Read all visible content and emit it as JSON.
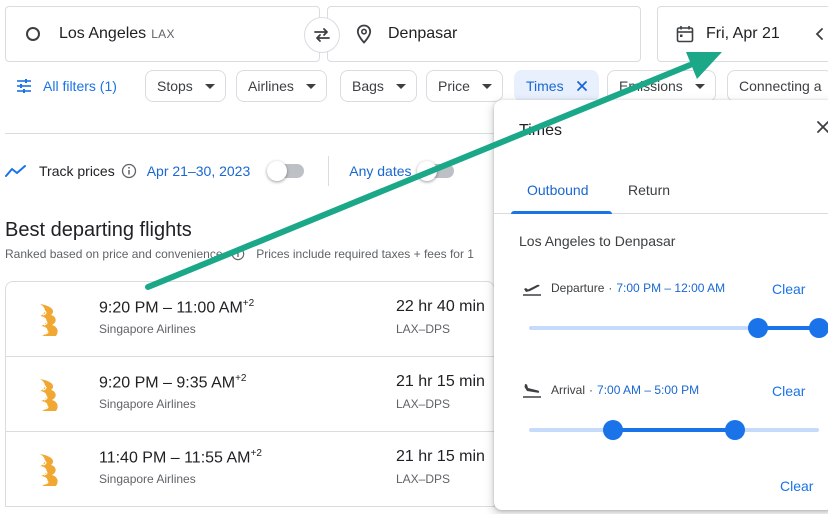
{
  "search": {
    "origin": "Los Angeles",
    "origin_code": "LAX",
    "destination": "Denpasar",
    "date": "Fri, Apr 21"
  },
  "filters": {
    "all_filters": "All filters (1)",
    "chips": [
      "Stops",
      "Airlines",
      "Bags",
      "Price",
      "Times",
      "Emissions",
      "Connecting a"
    ]
  },
  "track": {
    "label": "Track prices",
    "dates": "Apr 21–30, 2023",
    "any_dates": "Any dates"
  },
  "results": {
    "heading": "Best departing flights",
    "subtitle": "Ranked based on price and convenience",
    "taxes_note": "Prices include required taxes + fees for 1",
    "flights": [
      {
        "time": "9:20 PM – 11:00 AM",
        "offset": "+2",
        "airline": "Singapore Airlines",
        "duration": "22 hr 40 min",
        "route": "LAX–DPS"
      },
      {
        "time": "9:20 PM – 9:35 AM",
        "offset": "+2",
        "airline": "Singapore Airlines",
        "duration": "21 hr 15 min",
        "route": "LAX–DPS"
      },
      {
        "time": "11:40 PM – 11:55 AM",
        "offset": "+2",
        "airline": "Singapore Airlines",
        "duration": "21 hr 15 min",
        "route": "LAX–DPS"
      }
    ]
  },
  "times_panel": {
    "title": "Times",
    "tabs": [
      "Outbound",
      "Return"
    ],
    "route": "Los Angeles to Denpasar",
    "departure": {
      "label": "Departure",
      "range": "7:00 PM – 12:00 AM",
      "start": 0.79,
      "end": 1.0
    },
    "arrival": {
      "label": "Arrival",
      "range": "7:00 AM – 5:00 PM",
      "start": 0.29,
      "end": 0.71
    },
    "clear": "Clear"
  },
  "colors": {
    "accent": "#1a73e8",
    "annotation_arrow": "#1aa889",
    "airline_logo": "#f0a833"
  }
}
